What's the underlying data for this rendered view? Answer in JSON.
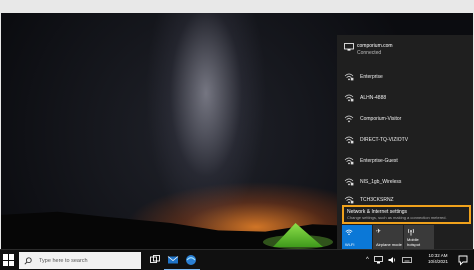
{
  "network_panel": {
    "connected": {
      "ssid": "comporium.com",
      "status": "Connected",
      "icon": "ethernet-icon"
    },
    "networks": [
      {
        "name": "Enterprise",
        "icon": "wifi-secured-icon"
      },
      {
        "name": "ALHN-4888",
        "icon": "wifi-secured-icon"
      },
      {
        "name": "Comporium-Visitor",
        "icon": "wifi-icon"
      },
      {
        "name": "DIRECT-TQ-VIZIOTV",
        "icon": "wifi-secured-icon"
      },
      {
        "name": "Enterprise-Guest",
        "icon": "wifi-secured-icon"
      },
      {
        "name": "NIS_1gb_Wireless",
        "icon": "wifi-secured-icon"
      },
      {
        "name": "TCH3CKSRNZ",
        "icon": "wifi-secured-icon"
      }
    ],
    "settings_link": {
      "title": "Network & Internet settings",
      "subtitle": "Change settings, such as making a connection metered."
    },
    "quick_actions": [
      {
        "label": "Wi-Fi",
        "icon": "wifi-icon",
        "active": true
      },
      {
        "label": "Airplane mode",
        "icon": "airplane-icon",
        "active": false
      },
      {
        "label": "Mobile\nhotspot",
        "icon": "hotspot-icon",
        "active": false
      }
    ]
  },
  "taskbar": {
    "search_placeholder": "Type here to search",
    "time": "10:32 AM",
    "date": "10/4/2021",
    "accent": "#f0a21c"
  }
}
